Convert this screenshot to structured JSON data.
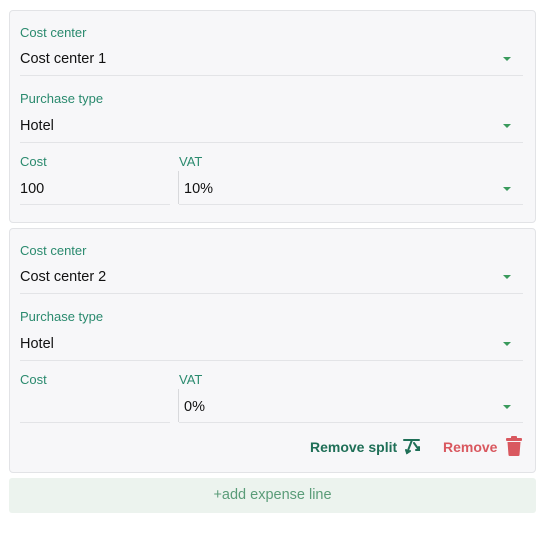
{
  "splits": [
    {
      "cost_center_label": "Cost center",
      "cost_center_value": "Cost center 1",
      "purchase_type_label": "Purchase type",
      "purchase_type_value": "Hotel",
      "cost_label": "Cost",
      "cost_value": "100",
      "vat_label": "VAT",
      "vat_value": "10%"
    },
    {
      "cost_center_label": "Cost center",
      "cost_center_value": "Cost center 2",
      "purchase_type_label": "Purchase type",
      "purchase_type_value": "Hotel",
      "cost_label": "Cost",
      "cost_value": "",
      "vat_label": "VAT",
      "vat_value": "0%",
      "remove_split_label": "Remove split",
      "remove_label": "Remove"
    }
  ],
  "add_expense_line_label": "+add expense line",
  "colors": {
    "label": "#2a8a6e",
    "caret": "#3a9a5c",
    "remove_split": "#1f6f57",
    "remove": "#d9585f",
    "add_line_bg": "#ecf3ee"
  },
  "icons": {
    "dropdown": "chevron-down-icon",
    "remove_split": "split-arrows-icon",
    "remove": "trash-icon"
  }
}
